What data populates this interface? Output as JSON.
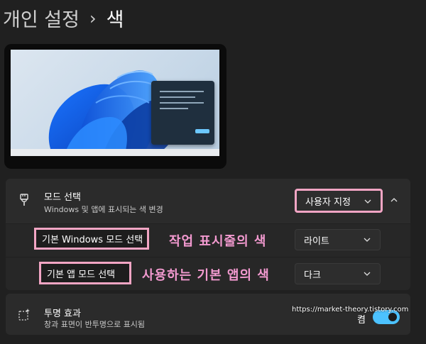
{
  "breadcrumb": {
    "parent": "개인 설정",
    "separator": "›",
    "current": "색"
  },
  "mode": {
    "title": "모드 선택",
    "description": "Windows 및 앱에 표시되는 색 변경",
    "value": "사용자 지정"
  },
  "windows_mode": {
    "label": "기본 Windows 모드 선택",
    "value": "라이트",
    "annotation": "작업 표시줄의 색"
  },
  "app_mode": {
    "label": "기본 앱 모드 선택",
    "value": "다크",
    "annotation": "사용하는 기본 앱의 색"
  },
  "transparency": {
    "title": "투명 효과",
    "description": "창과 표면이 반투명으로 표시됨",
    "toggle_label": "켬",
    "enabled": true
  },
  "watermark": "https://market-theory.tistory.com",
  "colors": {
    "accent": "#4cc2ff",
    "annotation": "#f39ad0",
    "highlight": "#f2a5c4"
  },
  "icons": [
    "brush-icon",
    "transparency-icon",
    "chevron-down-icon",
    "chevron-up-icon"
  ]
}
